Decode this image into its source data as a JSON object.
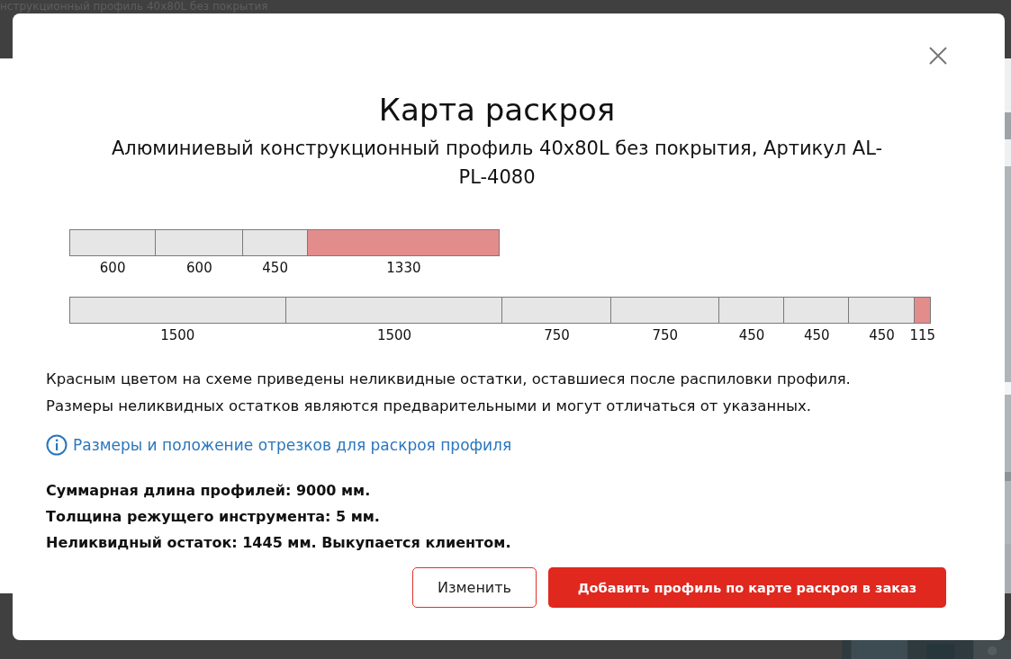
{
  "background": {
    "heading": "нструкционный профиль 40х80L без покрытия"
  },
  "dialog": {
    "title": "Карта раскроя",
    "subtitle": "Алюминиевый конструкционный профиль 40х80L без покрытия, Артикул AL-PL-4080",
    "bars": [
      {
        "segments": [
          {
            "label": "600",
            "waste": false
          },
          {
            "label": "600",
            "waste": false
          },
          {
            "label": "450",
            "waste": false
          },
          {
            "label": "1330",
            "waste": true
          }
        ]
      },
      {
        "segments": [
          {
            "label": "1500",
            "waste": false
          },
          {
            "label": "1500",
            "waste": false
          },
          {
            "label": "750",
            "waste": false
          },
          {
            "label": "750",
            "waste": false
          },
          {
            "label": "450",
            "waste": false
          },
          {
            "label": "450",
            "waste": false
          },
          {
            "label": "450",
            "waste": false
          },
          {
            "label": "115",
            "waste": true
          }
        ]
      }
    ],
    "notes": [
      "Красным цветом на схеме приведены неликвидные остатки, оставшиеся после распиловки профиля.",
      "Размеры неликвидных остатков являются предварительными и могут отличаться от указанных."
    ],
    "info_link": "Размеры и положение отрезков для раскроя профиля",
    "summary": [
      "Суммарная длина профилей: 9000 мм.",
      "Толщина режущего инструмента: 5 мм.",
      "Неликвидный остаток: 1445 мм. Выкупается клиентом."
    ],
    "buttons": [
      {
        "label": "Изменить",
        "kind": "secondary"
      },
      {
        "label": "Добавить профиль по карте раскроя в заказ",
        "kind": "primary"
      }
    ]
  }
}
